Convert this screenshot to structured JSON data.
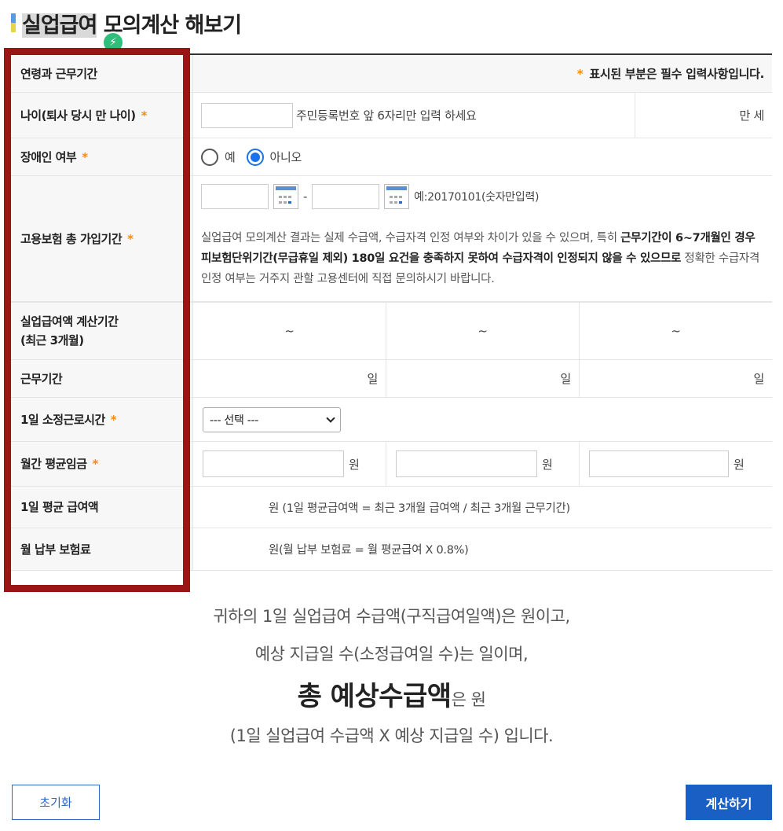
{
  "title": {
    "highlight": "실업급여",
    "rest": " 모의계산 해보기"
  },
  "colors": {
    "required": "#f08b1d",
    "accent": "#1a5fc4",
    "highlight_box": "#9a1616"
  },
  "header_row": {
    "label": "연령과 근무기간",
    "required_mark": "*",
    "required_note": "표시된 부분은 필수 입력사항입니다."
  },
  "age": {
    "label": "나이(퇴사 당시 만 나이)",
    "hint": "주민등록번호 앞 6자리만 입력 하세요",
    "unit": "만 세"
  },
  "disabled": {
    "label": "장애인 여부",
    "options": [
      "예",
      "아니오"
    ],
    "selected": "아니오"
  },
  "insurance": {
    "label": "고용보험 총 가입기간",
    "separator": "-",
    "date_hint": "예:20170101(숫자만입력)",
    "notice_1": "실업급여 모의계산 결과는 실제 수급액, 수급자격 인정 여부와 차이가 있을 수 있으며, 특히 ",
    "notice_bold": "근무기간이 6~7개월인 경우 피보험단위기간(무급휴일 제외) 180일 요건을 충족하지 못하여 수급자격이 인정되지 않을 수 있으므로",
    "notice_2": " 정확한 수급자격 인정 여부는 거주지 관할 고용센터에 직접 문의하시기 바랍니다."
  },
  "calc_period": {
    "label_1": "실업급여액 계산기간",
    "label_2": "(최근 3개월)",
    "cols": [
      "~",
      "~",
      "~"
    ]
  },
  "work_period": {
    "label": "근무기간",
    "unit": "일"
  },
  "daily_hours": {
    "label": "1일 소정근로시간",
    "select_value": "--- 선택 ---"
  },
  "monthly_wage": {
    "label": "월간 평균임금",
    "unit": "원"
  },
  "daily_benefit": {
    "label": "1일 평균 급여액",
    "text": "원 (1일 평균급여액 = 최근 3개월 급여액 / 최근 3개월 근무기간)"
  },
  "premium": {
    "label": "월 납부 보험료",
    "text": "원(월 납부 보험료 = 월 평균급여 X 0.8%)"
  },
  "result": {
    "line1": "귀하의 1일 실업급여 수급액(구직급여일액)은 원이고,",
    "line2": "예상 지급일 수(소정급여일 수)는 일이며,",
    "line3_big": "총 예상수급액",
    "line3_small": "은 원",
    "line4": "(1일 실업급여 수급액 X 예상 지급일 수) 입니다."
  },
  "buttons": {
    "reset": "초기화",
    "calculate": "계산하기"
  }
}
